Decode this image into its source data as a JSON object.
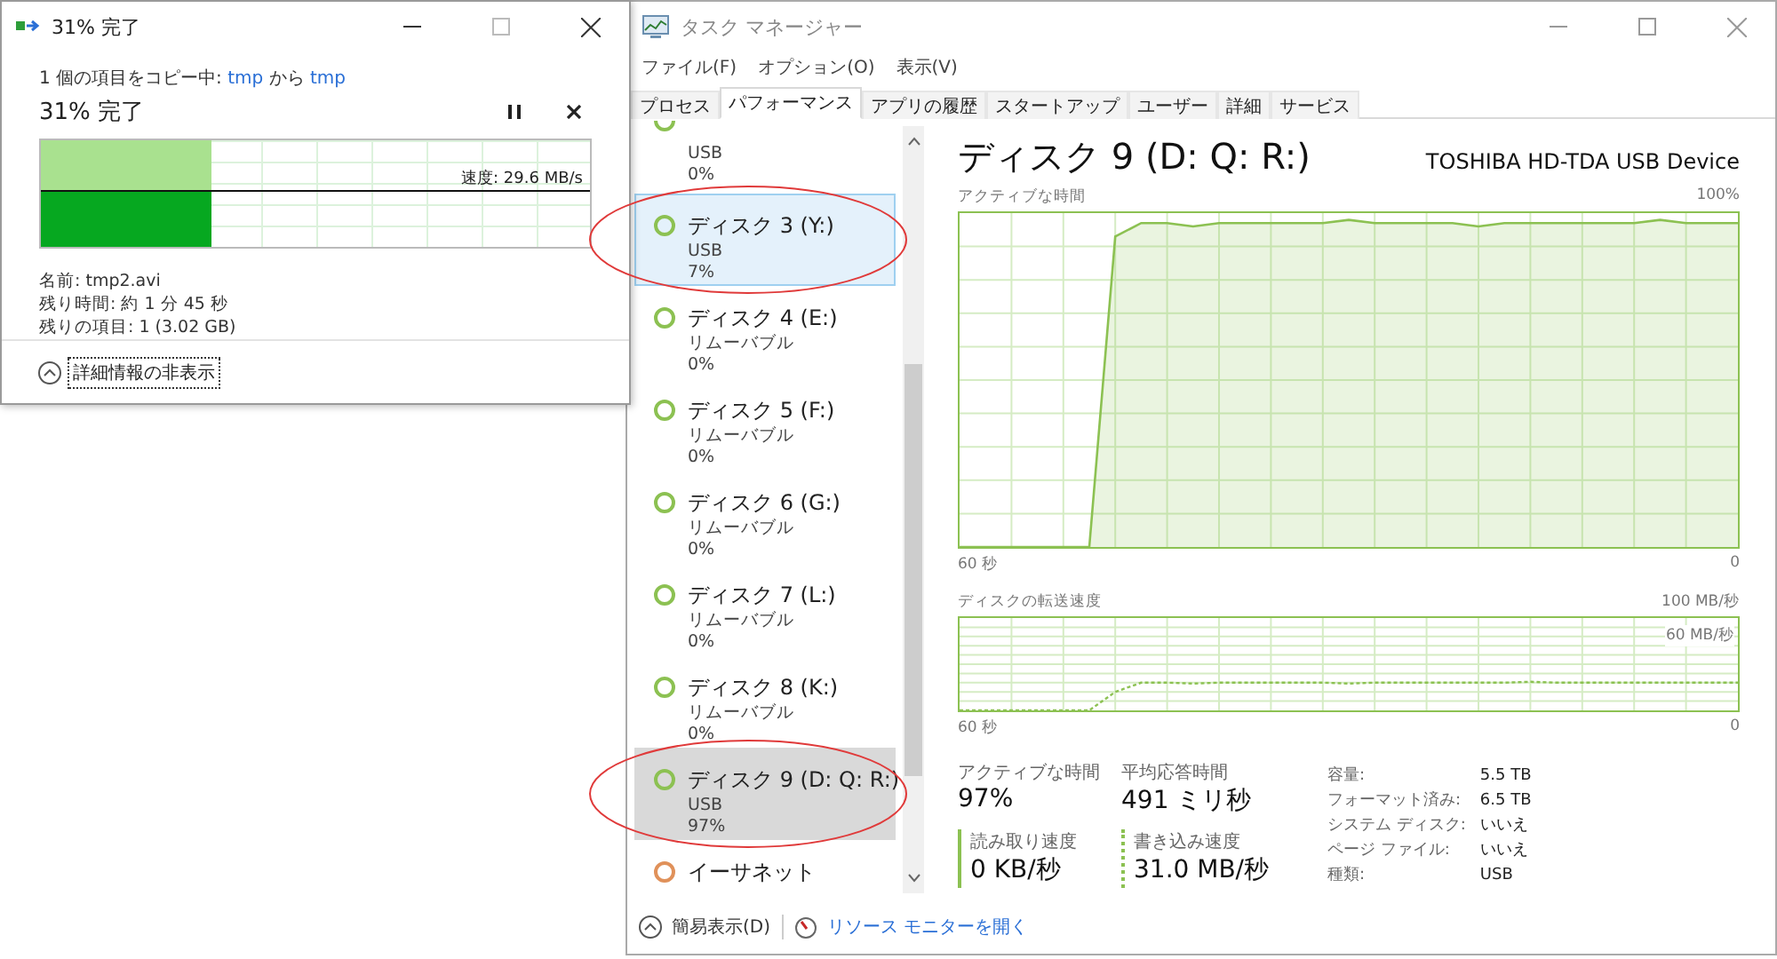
{
  "copy_dialog": {
    "title": "31% 完了",
    "status": {
      "prefix": "1 個の項目をコピー中:",
      "source": "tmp",
      "middle": "から",
      "destination": "tmp"
    },
    "heading": "31% 完了",
    "level": 0.31,
    "speed": "速度: 29.6 MB/s",
    "details": [
      "名前: tmp2.avi",
      "残り時間: 約 1 分 45 秒",
      "残りの項目: 1 (3.02 GB)"
    ],
    "toggle": "詳細情報の非表示"
  },
  "task_manager": {
    "title": "タスク マネージャー",
    "menu": [
      "ファイル(F)",
      "オプション(O)",
      "表示(V)"
    ],
    "tabs": [
      {
        "label": "プロセス",
        "selected": false
      },
      {
        "label": "パフォーマンス",
        "selected": true
      },
      {
        "label": "アプリの履歴",
        "selected": false
      },
      {
        "label": "スタートアップ",
        "selected": false
      },
      {
        "label": "ユーザー",
        "selected": false
      },
      {
        "label": "詳細",
        "selected": false
      },
      {
        "label": "サービス",
        "selected": false
      }
    ],
    "sidebar": [
      {
        "kind": "partial",
        "type": "USB",
        "value": "0%",
        "color": "#8cc152",
        "selected": false,
        "hovered": false,
        "circled": false
      },
      {
        "kind": "full",
        "name": "ディスク 3 (Y:)",
        "type": "USB",
        "value": "7%",
        "color": "#8cc152",
        "selected": false,
        "hovered": true,
        "circled": true
      },
      {
        "kind": "full",
        "name": "ディスク 4 (E:)",
        "type": "リムーバブル",
        "value": "0%",
        "color": "#8cc152",
        "selected": false,
        "hovered": false,
        "circled": false
      },
      {
        "kind": "full",
        "name": "ディスク 5 (F:)",
        "type": "リムーバブル",
        "value": "0%",
        "color": "#8cc152",
        "selected": false,
        "hovered": false,
        "circled": false
      },
      {
        "kind": "full",
        "name": "ディスク 6 (G:)",
        "type": "リムーバブル",
        "value": "0%",
        "color": "#8cc152",
        "selected": false,
        "hovered": false,
        "circled": false
      },
      {
        "kind": "full",
        "name": "ディスク 7 (L:)",
        "type": "リムーバブル",
        "value": "0%",
        "color": "#8cc152",
        "selected": false,
        "hovered": false,
        "circled": false
      },
      {
        "kind": "full",
        "name": "ディスク 8 (K:)",
        "type": "リムーバブル",
        "value": "0%",
        "color": "#8cc152",
        "selected": false,
        "hovered": false,
        "circled": false
      },
      {
        "kind": "full",
        "name": "ディスク 9 (D: Q: R:)",
        "type": "USB",
        "value": "97%",
        "color": "#8cc152",
        "selected": true,
        "hovered": false,
        "circled": true
      },
      {
        "kind": "cut",
        "name": "イーサネット",
        "color": "#e0915a",
        "selected": false,
        "hovered": false,
        "circled": false
      }
    ],
    "detail": {
      "title": "ディスク 9 (D: Q: R:)",
      "model": "TOSHIBA HD-TDA USB Device",
      "active_chart": {
        "kind": "area",
        "title": "アクティブな時間",
        "max_label": "100%",
        "start_label": "60 秒",
        "end_label": "0"
      },
      "transfer_chart": {
        "kind": "line",
        "title": "ディスクの転送速度",
        "max_label": "100 MB/秒",
        "mid_label": "60 MB/秒",
        "start_label": "60 秒",
        "end_label": "0"
      },
      "stats": [
        {
          "label": "アクティブな時間",
          "value": "97%"
        },
        {
          "label": "平均応答時間",
          "value": "491 ミリ秒"
        }
      ],
      "rates": [
        {
          "label": "読み取り速度",
          "value": "0 KB/秒",
          "kind": "solid"
        },
        {
          "label": "書き込み速度",
          "value": "31.0 MB/秒",
          "kind": "dashed"
        }
      ],
      "properties": [
        {
          "label": "容量:",
          "value": "5.5 TB"
        },
        {
          "label": "フォーマット済み:",
          "value": "6.5 TB"
        },
        {
          "label": "システム ディスク:",
          "value": "いいえ"
        },
        {
          "label": "ページ ファイル:",
          "value": "いいえ"
        },
        {
          "label": "種類:",
          "value": "USB"
        }
      ]
    },
    "footer": {
      "compact": "簡易表示(D)",
      "resource_monitor": "リソース モニターを開く"
    }
  }
}
